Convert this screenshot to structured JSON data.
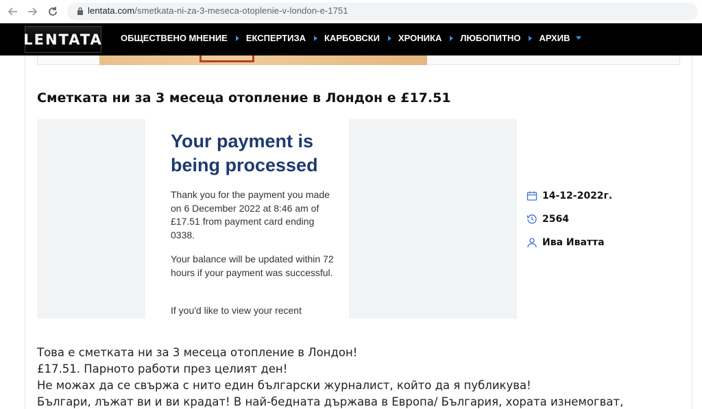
{
  "browser": {
    "url_host": "lentata.com",
    "url_path": "/smetkata-ni-za-3-meseca-otoplenie-v-london-e-1751"
  },
  "site": {
    "logo_text": "LENTATA",
    "menu": [
      {
        "label": "ОБЩЕСТВЕНО МНЕНИЕ"
      },
      {
        "label": "ЕКСПЕРТИЗА"
      },
      {
        "label": "КАРБОВСКИ"
      },
      {
        "label": "ХРОНИКА"
      },
      {
        "label": "ЛЮБОПИТНО"
      },
      {
        "label": "АРХИВ"
      }
    ],
    "accent_color": "#3a8dde"
  },
  "article": {
    "title": "Сметката ни за 3 месеца отопление в Лондон е £17.51",
    "image": {
      "title": "Your payment is being processed",
      "paragraph1": "Thank you for the payment you made on 6 December 2022 at 8:46 am of £17.51 from payment card ending 0338.",
      "paragraph2": "Your balance will be updated within 72 hours if your payment was successful.",
      "paragraph3": "If you'd like to view your recent"
    },
    "meta": {
      "date": "14-12-2022г.",
      "views": "2564",
      "author": "Ива Иватта"
    },
    "body_lines": [
      "Това е сметката ни за 3 месеца отопление в Лондон!",
      "£17.51. Парното работи през целият ден!",
      "Не можах да се свържа с нито един български журналист, който да я публикува!",
      "Българи, лъжат ви и ви крадат! В най-бедната държава в Европа/ България, хората изнемогват,"
    ]
  }
}
